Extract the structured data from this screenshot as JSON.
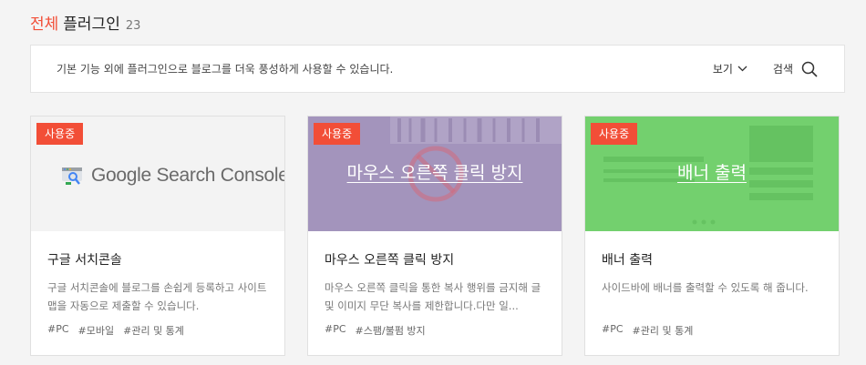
{
  "header": {
    "title_accent": "전체",
    "title_main": "플러그인",
    "count": "23"
  },
  "info": {
    "description": "기본 기능 외에 플러그인으로 블로그를 더욱 풍성하게 사용할 수 있습니다.",
    "view_label": "보기",
    "search_label": "검색"
  },
  "cards": [
    {
      "badge": "사용중",
      "thumb_logo_text": "Google Search Console",
      "title": "구글 서치콘솔",
      "desc": "구글 서치콘솔에 블로그를 손쉽게 등록하고 사이트맵을 자동으로 제출할 수 있습니다.",
      "tags": [
        "#PC",
        "#모바일",
        "#관리 및 통계"
      ]
    },
    {
      "badge": "사용중",
      "thumb_title": "마우스 오른쪽 클릭 방지",
      "title": "마우스 오른쪽 클릭 방지",
      "desc": "마우스 오른쪽 클릭을 통한 복사 행위를 금지해 글 및 이미지 무단 복사를 제한합니다.다만 일...",
      "tags": [
        "#PC",
        "#스팸/불펌 방지"
      ]
    },
    {
      "badge": "사용중",
      "thumb_title": "배너 출력",
      "title": "배너 출력",
      "desc": "사이드바에 배너를 출력할 수 있도록 해 줍니다.",
      "tags": [
        "#PC",
        "#관리 및 통계"
      ]
    }
  ],
  "colors": {
    "accent": "#f24e37",
    "purple_overlay": "#a394bc",
    "green_overlay": "#73d06e"
  },
  "icons": {
    "view": "chevron-down-icon",
    "search": "search-icon",
    "gsc": "google-search-console-icon"
  }
}
